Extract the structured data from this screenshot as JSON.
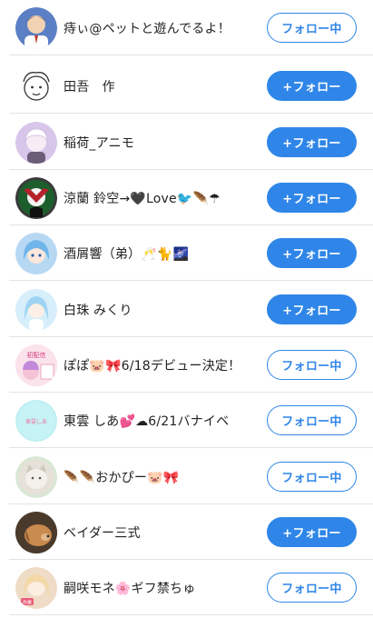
{
  "users": [
    {
      "name": "痔ぃ@ペットと遊んでるよ！",
      "button": "フォロー中",
      "state": "following",
      "avatar": "man-caricature-avatar",
      "bg": "#5a7fc4"
    },
    {
      "name": "田吾　作",
      "button": "+フォロー",
      "state": "follow",
      "avatar": "sketch-face-avatar",
      "bg": "#ffffff"
    },
    {
      "name": "稲荷_アニモ",
      "button": "+フォロー",
      "state": "follow",
      "avatar": "anime-boy-avatar",
      "bg": "#d8c6ea"
    },
    {
      "name": "涼蘭 鈴空→🖤Love🐦🪶☂",
      "button": "+フォロー",
      "state": "follow",
      "avatar": "dark-character-avatar",
      "bg": "#3a3a3a"
    },
    {
      "name": "酒屑響（弟）🥂🐈🌌",
      "button": "+フォロー",
      "state": "follow",
      "avatar": "blue-hair-girl-avatar",
      "bg": "#b7d8f3"
    },
    {
      "name": "白珠 みくり",
      "button": "+フォロー",
      "state": "follow",
      "avatar": "light-blue-hair-avatar",
      "bg": "#d7eefb"
    },
    {
      "name": "ぽぽ🐷🎀6/18デビュー決定！",
      "button": "フォロー中",
      "state": "following",
      "avatar": "pink-poster-avatar",
      "bg": "#f4c9da"
    },
    {
      "name": "東雲 しあ💕☁6/21バナイベ",
      "button": "フォロー中",
      "state": "following",
      "avatar": "pastel-logo-avatar",
      "bg": "#bfeff2"
    },
    {
      "name": "🪶🪶おかぴー🐷🎀",
      "button": "フォロー中",
      "state": "following",
      "avatar": "white-cat-avatar",
      "bg": "#d9e7d5"
    },
    {
      "name": "ベイダー三式",
      "button": "+フォロー",
      "state": "follow",
      "avatar": "dog-photo-avatar",
      "bg": "#8a5a33"
    },
    {
      "name": "嗣咲モネ🌸ギフ禁ちゅ",
      "button": "フォロー中",
      "state": "following",
      "avatar": "cream-hair-girl-avatar",
      "bg": "#efdcc6"
    }
  ]
}
